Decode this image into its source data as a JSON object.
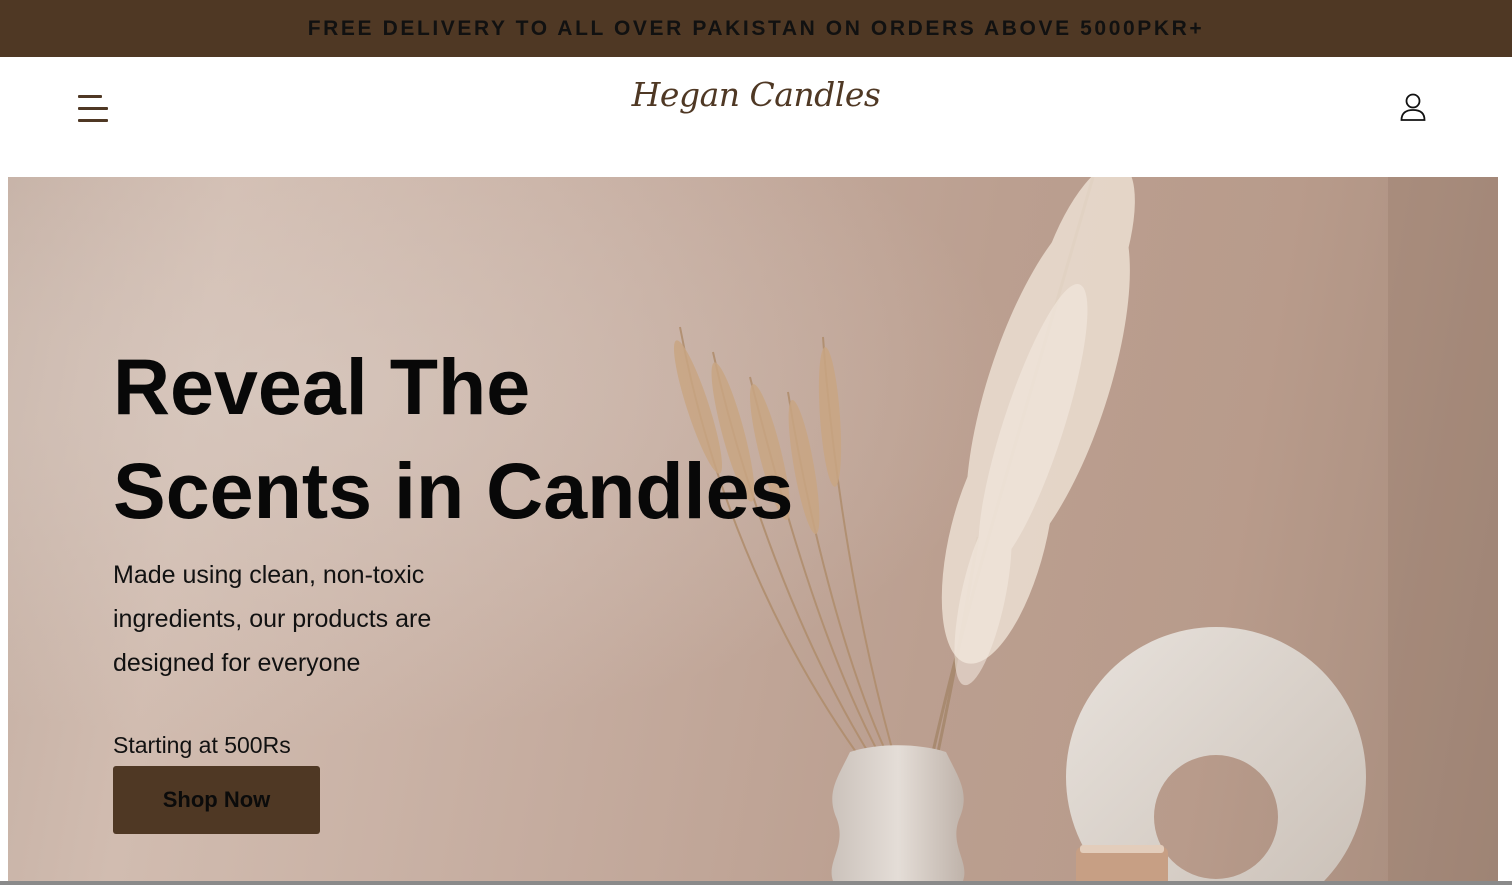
{
  "announcement": {
    "text": "FREE DELIVERY TO ALL OVER PAKISTAN ON ORDERS ABOVE 5000PKR+"
  },
  "header": {
    "menu_icon": "hamburger-menu-icon",
    "logo_text": "Hegan Candles",
    "account_icon": "user-account-icon"
  },
  "hero": {
    "title_line1": "Reveal The",
    "title_line2": "Scents in Candles",
    "subtitle": "Made using clean, non-toxic ingredients, our products are designed for everyone",
    "price_text": "Starting at 500Rs",
    "cta_label": "Shop Now"
  },
  "colors": {
    "brand_brown": "#4f3824",
    "hero_bg": "#c3aea2",
    "text_dark": "#080808"
  }
}
